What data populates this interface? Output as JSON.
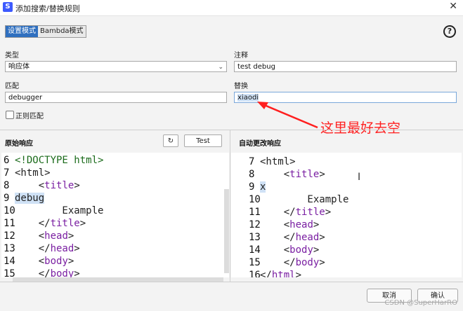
{
  "window": {
    "title": "添加搜索/替换规则",
    "close_glyph": "✕",
    "app_icon_glyph": "S"
  },
  "modes": {
    "items": [
      "设置模式",
      "Bambda模式"
    ],
    "active": 0
  },
  "help_glyph": "?",
  "form": {
    "type_label": "类型",
    "type_value": "响应体",
    "comment_label": "注释",
    "comment_value": "test debug",
    "match_label": "匹配",
    "match_value": "debugger",
    "replace_label": "替换",
    "replace_value": "xiaodi",
    "regex_label": "正则匹配"
  },
  "annotation": {
    "text": "这里最好去空",
    "color": "#ff1f1f"
  },
  "left_pane": {
    "title": "原始响应",
    "refresh_glyph": "↻",
    "test_label": "Test",
    "lines": [
      {
        "n": "6",
        "parts": [
          {
            "t": "<!DOCTYPE html>",
            "c": "dt"
          }
        ]
      },
      {
        "n": "7",
        "parts": [
          {
            "t": "<html>",
            "c": ""
          }
        ]
      },
      {
        "n": "8",
        "parts": [
          {
            "t": "    <",
            "c": ""
          },
          {
            "t": "title",
            "c": "tag"
          },
          {
            "t": ">",
            "c": ""
          }
        ]
      },
      {
        "n": "9",
        "parts": [
          {
            "t": "debug",
            "c": "hl"
          }
        ]
      },
      {
        "n": "10",
        "parts": [
          {
            "t": "        Example",
            "c": ""
          }
        ]
      },
      {
        "n": "11",
        "parts": [
          {
            "t": "    </",
            "c": ""
          },
          {
            "t": "title",
            "c": "tag"
          },
          {
            "t": ">",
            "c": ""
          }
        ]
      },
      {
        "n": "12",
        "parts": [
          {
            "t": "    <",
            "c": ""
          },
          {
            "t": "head",
            "c": "tag"
          },
          {
            "t": ">",
            "c": ""
          }
        ]
      },
      {
        "n": "13",
        "parts": [
          {
            "t": "    </",
            "c": ""
          },
          {
            "t": "head",
            "c": "tag"
          },
          {
            "t": ">",
            "c": ""
          }
        ]
      },
      {
        "n": "14",
        "parts": [
          {
            "t": "    <",
            "c": ""
          },
          {
            "t": "body",
            "c": "tag"
          },
          {
            "t": ">",
            "c": ""
          }
        ]
      },
      {
        "n": "15",
        "parts": [
          {
            "t": "    </",
            "c": ""
          },
          {
            "t": "body",
            "c": "tag"
          },
          {
            "t": ">",
            "c": ""
          }
        ]
      }
    ]
  },
  "right_pane": {
    "title": "自动更改响应",
    "cursor_glyph": "I",
    "lines": [
      {
        "n": "7",
        "parts": [
          {
            "t": "<html>",
            "c": ""
          }
        ]
      },
      {
        "n": "8",
        "parts": [
          {
            "t": "    <",
            "c": ""
          },
          {
            "t": "title",
            "c": "tag"
          },
          {
            "t": ">",
            "c": ""
          }
        ]
      },
      {
        "n": "9",
        "parts": [
          {
            "t": "x",
            "c": "hl"
          }
        ]
      },
      {
        "n": "10",
        "parts": [
          {
            "t": "        Example",
            "c": ""
          }
        ]
      },
      {
        "n": "11",
        "parts": [
          {
            "t": "    </",
            "c": ""
          },
          {
            "t": "title",
            "c": "tag"
          },
          {
            "t": ">",
            "c": ""
          }
        ]
      },
      {
        "n": "12",
        "parts": [
          {
            "t": "    <",
            "c": ""
          },
          {
            "t": "head",
            "c": "tag"
          },
          {
            "t": ">",
            "c": ""
          }
        ]
      },
      {
        "n": "13",
        "parts": [
          {
            "t": "    </",
            "c": ""
          },
          {
            "t": "head",
            "c": "tag"
          },
          {
            "t": ">",
            "c": ""
          }
        ]
      },
      {
        "n": "14",
        "parts": [
          {
            "t": "    <",
            "c": ""
          },
          {
            "t": "body",
            "c": "tag"
          },
          {
            "t": ">",
            "c": ""
          }
        ]
      },
      {
        "n": "15",
        "parts": [
          {
            "t": "    </",
            "c": ""
          },
          {
            "t": "body",
            "c": "tag"
          },
          {
            "t": ">",
            "c": ""
          }
        ]
      },
      {
        "n": "16",
        "parts": [
          {
            "t": "</",
            "c": ""
          },
          {
            "t": "html",
            "c": "tag"
          },
          {
            "t": ">",
            "c": ""
          }
        ]
      }
    ]
  },
  "footer": {
    "cancel_label": "取消",
    "ok_label": "确认",
    "watermark": "CSDN @SuperHarRO"
  }
}
